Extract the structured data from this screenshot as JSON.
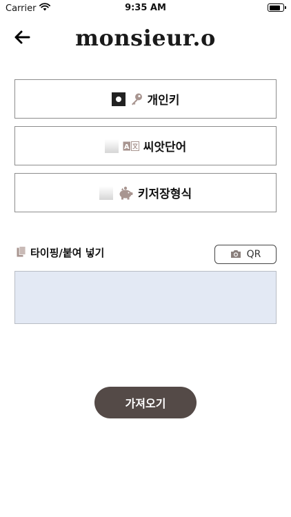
{
  "status_bar": {
    "carrier": "Carrier",
    "time": "9:35 AM"
  },
  "header": {
    "brand": "monsieur.o",
    "back_icon": "arrow-left-icon"
  },
  "options": [
    {
      "label": "개인키",
      "icon": "key-icon",
      "selected": true
    },
    {
      "label": "씨앗단어",
      "icon": "translate-icon",
      "selected": false
    },
    {
      "label": "키저장형식",
      "icon": "piggy-bank-icon",
      "selected": false
    }
  ],
  "input": {
    "label": "타이핑/붙여 넣기",
    "label_icon": "paste-icon",
    "qr_label": "QR",
    "qr_icon": "camera-icon",
    "value": ""
  },
  "actions": {
    "import_label": "가져오기"
  },
  "colors": {
    "input_bg": "#e3e9f4",
    "primary_button": "#544a47"
  }
}
